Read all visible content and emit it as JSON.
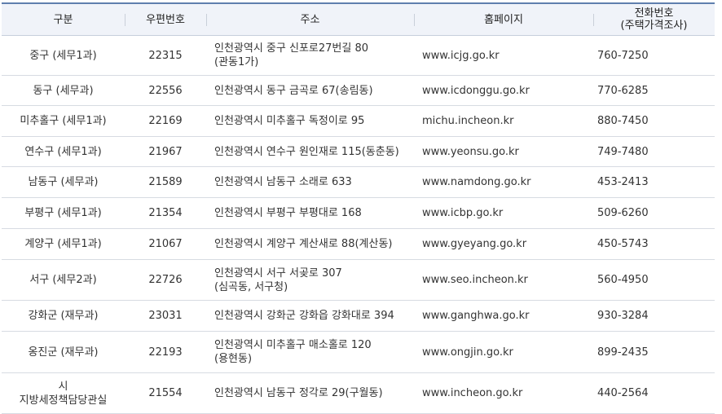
{
  "table": {
    "headers": {
      "division": "구분",
      "postal_code": "우편번호",
      "address": "주소",
      "homepage": "홈페이지",
      "phone": "전화번호\n(주택가격조사)"
    },
    "rows": [
      {
        "division": "중구 (세무1과)",
        "postal_code": "22315",
        "address": "인천광역시 중구 신포로27번길 80\n(관동1가)",
        "homepage": "www.icjg.go.kr",
        "phone": "760-7250"
      },
      {
        "division": "동구 (세무과)",
        "postal_code": "22556",
        "address": "인천광역시 동구 금곡로 67(송림동)",
        "homepage": "www.icdonggu.go.kr",
        "phone": "770-6285"
      },
      {
        "division": "미추홀구 (세무1과)",
        "postal_code": "22169",
        "address": "인천광역시 미추홀구 독정이로 95",
        "homepage": "michu.incheon.kr",
        "phone": "880-7450"
      },
      {
        "division": "연수구 (세무1과)",
        "postal_code": "21967",
        "address": "인천광역시 연수구 원인재로 115(동춘동)",
        "homepage": "www.yeonsu.go.kr",
        "phone": "749-7480"
      },
      {
        "division": "남동구 (세무과)",
        "postal_code": "21589",
        "address": "인천광역시 남동구 소래로 633",
        "homepage": "www.namdong.go.kr",
        "phone": "453-2413"
      },
      {
        "division": "부평구 (세무1과)",
        "postal_code": "21354",
        "address": "인천광역시 부평구 부평대로 168",
        "homepage": "www.icbp.go.kr",
        "phone": "509-6260"
      },
      {
        "division": "계양구 (세무1과)",
        "postal_code": "21067",
        "address": "인천광역시 계양구 계산새로 88(계산동)",
        "homepage": "www.gyeyang.go.kr",
        "phone": "450-5743"
      },
      {
        "division": "서구 (세무2과)",
        "postal_code": "22726",
        "address": "인천광역시 서구 서곶로 307\n(심곡동, 서구청)",
        "homepage": "www.seo.incheon.kr",
        "phone": "560-4950"
      },
      {
        "division": "강화군 (재무과)",
        "postal_code": "23031",
        "address": "인천광역시 강화군 강화읍 강화대로 394",
        "homepage": "www.ganghwa.go.kr",
        "phone": "930-3284"
      },
      {
        "division": "옹진군 (재무과)",
        "postal_code": "22193",
        "address": "인천광역시 미추홀구 매소홀로 120\n(용현동)",
        "homepage": "www.ongjin.go.kr",
        "phone": "899-2435"
      },
      {
        "division": "시\n지방세정책담당관실",
        "postal_code": "21554",
        "address": "인천광역시 남동구 정각로 29(구월동)",
        "homepage": "www.incheon.go.kr",
        "phone": "440-2564"
      }
    ]
  }
}
